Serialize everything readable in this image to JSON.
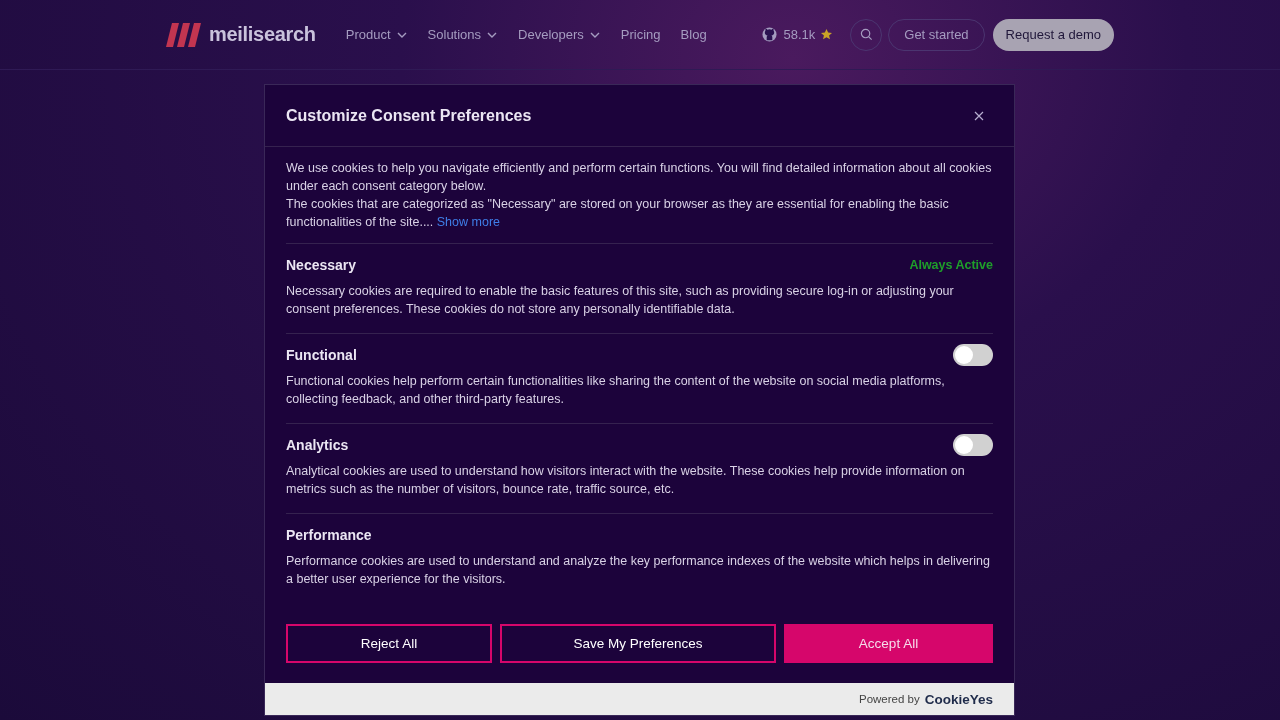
{
  "navbar": {
    "logo": "meilisearch",
    "menu": [
      {
        "label": "Product",
        "dropdown": true
      },
      {
        "label": "Solutions",
        "dropdown": true
      },
      {
        "label": "Developers",
        "dropdown": true
      },
      {
        "label": "Pricing",
        "dropdown": false
      },
      {
        "label": "Blog",
        "dropdown": false
      }
    ],
    "github_stars": "58.1k",
    "get_started": "Get started",
    "request_demo": "Request a demo"
  },
  "dialog": {
    "title": "Customize Consent Preferences",
    "intro": "We use cookies to help you navigate efficiently and perform certain functions. You will find detailed information about all cookies under each consent category below.",
    "intro_2": "The cookies that are categorized as \"Necessary\" are stored on your browser as they are essential for enabling the basic functionalities of the site....",
    "show_more": "Show more",
    "categories": [
      {
        "name": "Necessary",
        "kind": "always",
        "status": "Always Active",
        "description": "Necessary cookies are required to enable the basic features of this site, such as providing secure log-in or adjusting your consent preferences. These cookies do not store any personally identifiable data."
      },
      {
        "name": "Functional",
        "kind": "toggle",
        "checked": false,
        "description": "Functional cookies help perform certain functionalities like sharing the content of the website on social media platforms, collecting feedback, and other third-party features."
      },
      {
        "name": "Analytics",
        "kind": "toggle",
        "checked": false,
        "description": "Analytical cookies are used to understand how visitors interact with the website. These cookies help provide information on metrics such as the number of visitors, bounce rate, traffic source, etc."
      },
      {
        "name": "Performance",
        "kind": "plain",
        "description": "Performance cookies are used to understand and analyze the key performance indexes of the website which helps in delivering a better user experience for the visitors."
      }
    ],
    "buttons": [
      {
        "label": "Reject All",
        "kind": "outline"
      },
      {
        "label": "Save My Preferences",
        "kind": "outline"
      },
      {
        "label": "Accept All",
        "kind": "primary"
      }
    ],
    "powered_by": "Powered by",
    "brand": "CookieYes"
  }
}
